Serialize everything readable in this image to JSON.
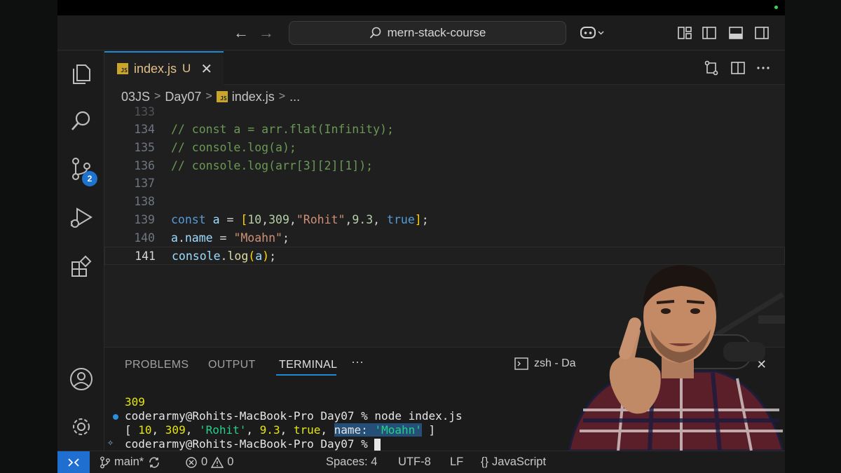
{
  "titlebar": {
    "search_text": "mern-stack-course",
    "back_arrow": "←",
    "forward_arrow": "→"
  },
  "activity_bar": {
    "scm_badge": "2"
  },
  "tab": {
    "filename": "index.js",
    "status": "U",
    "close": "✕",
    "icon_text": "JS"
  },
  "breadcrumb": {
    "items": [
      "03JS",
      "Day07",
      "index.js",
      "..."
    ],
    "separator": ">"
  },
  "editor": {
    "lines": [
      {
        "num": "133",
        "active": false
      },
      {
        "num": "134",
        "active": false
      },
      {
        "num": "135",
        "active": false
      },
      {
        "num": "136",
        "active": false
      },
      {
        "num": "137",
        "active": false
      },
      {
        "num": "138",
        "active": false
      },
      {
        "num": "139",
        "active": false
      },
      {
        "num": "140",
        "active": false
      },
      {
        "num": "141",
        "active": true
      }
    ],
    "code": {
      "l134": "// const a = arr.flat(Infinity);",
      "l135": "// console.log(a);",
      "l136": "// console.log(arr[3][2][1]);",
      "l139_kw": "const",
      "l139_var": "a",
      "l139_eq": " = ",
      "l139_open": "[",
      "l139_n1": "10",
      "l139_n2": "309",
      "l139_s": "\"Rohit\"",
      "l139_n3": "9.3",
      "l139_b": "true",
      "l139_close": "]",
      "l139_end": ";",
      "l140_var": "a",
      "l140_prop": "name",
      "l140_eq": " = ",
      "l140_s": "\"Moahn\"",
      "l140_end": ";",
      "l141_obj": "console",
      "l141_fn": "log",
      "l141_open": "(",
      "l141_arg": "a",
      "l141_close": ")",
      "l141_end": ";"
    }
  },
  "panel": {
    "tabs": [
      "PROBLEMS",
      "OUTPUT",
      "TERMINAL"
    ],
    "active_tab": "TERMINAL",
    "more": "···",
    "shell_label": "zsh - Da",
    "close": "✕",
    "terminal": {
      "out1": "309",
      "prompt1": "coderarmy@Rohits-MacBook-Pro Day07 % ",
      "cmd1": "node index.js",
      "arr_open": "[ ",
      "v1": "10",
      "v2": "309",
      "v3": "'Rohit'",
      "v4": "9.3",
      "v5": "true",
      "sel_key": "name: ",
      "sel_val": "'Moahn'",
      "arr_close": " ]",
      "prompt2": "coderarmy@Rohits-MacBook-Pro Day07 % "
    }
  },
  "statusbar": {
    "branch": "main*",
    "errors": "0",
    "warnings": "0",
    "spaces": "Spaces: 4",
    "encoding": "UTF-8",
    "eol": "LF",
    "language": "JavaScript"
  },
  "colors": {
    "accent": "#1f8ad2",
    "badge": "#1e73cf",
    "remote": "#1f6fd0"
  }
}
